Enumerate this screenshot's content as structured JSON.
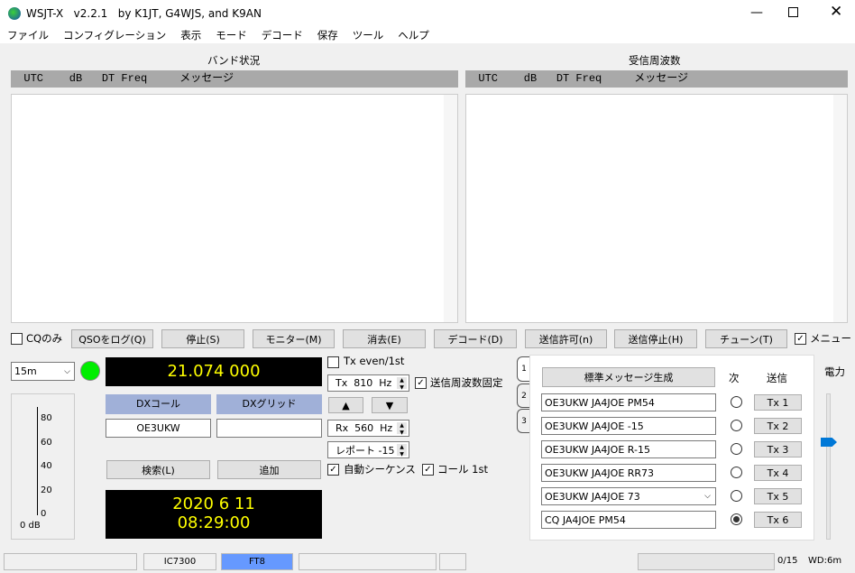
{
  "window": {
    "title": "WSJT-X   v2.2.1   by K1JT, G4WJS, and K9AN",
    "controls": [
      "minimize",
      "maximize",
      "close"
    ]
  },
  "menu": [
    "ファイル",
    "コンフィグレーション",
    "表示",
    "モード",
    "デコード",
    "保存",
    "ツール",
    "ヘルプ"
  ],
  "band_activity": {
    "title": "バンド状況",
    "header": "  UTC    dB   DT Freq     メッセージ"
  },
  "rx_frequency": {
    "title": "受信周波数",
    "header": "  UTC    dB   DT Freq     メッセージ"
  },
  "buttons": {
    "cq_only": "CQのみ",
    "log_qso": "QSOをログ(Q)",
    "stop": "停止(S)",
    "monitor": "モニター(M)",
    "erase": "消去(E)",
    "decode": "デコード(D)",
    "enable_tx": "送信許可(n)",
    "halt_tx": "送信停止(H)",
    "tune": "チューン(T)",
    "menus": "メニュー"
  },
  "checkboxes": {
    "cq_only": false,
    "menus": true,
    "tx_even": false,
    "hold_tx_freq": true,
    "auto_seq": true,
    "call_1st": true
  },
  "band": "15m",
  "frequency": "21.074 000",
  "meter": {
    "ticks": [
      "80",
      "60",
      "40",
      "20",
      "0"
    ],
    "label": "0 dB"
  },
  "dx": {
    "call_label": "DXコール",
    "grid_label": "DXグリッド",
    "call": "OE3UKW",
    "grid": ""
  },
  "lookup": "検索(L)",
  "add": "追加",
  "clock": {
    "date": "2020 6 11",
    "time": "08:29:00"
  },
  "tx_even_label": "Tx even/1st",
  "tx_freq": "Tx  810  Hz",
  "rx_freq": "Rx  560  Hz",
  "report": "レポート -15",
  "hold_tx_label": "送信周波数固定",
  "up": "▲",
  "down": "▼",
  "auto_seq_label": "自動シーケンス",
  "call_1st_label": "コール 1st",
  "tabs": [
    "1",
    "2",
    "3"
  ],
  "messages": {
    "generate": "標準メッセージ生成",
    "next_label": "次",
    "send_label": "送信",
    "rows": [
      {
        "text": "OE3UKW JA4JOE PM54",
        "tx": "Tx 1"
      },
      {
        "text": "OE3UKW JA4JOE -15",
        "tx": "Tx 2"
      },
      {
        "text": "OE3UKW JA4JOE R-15",
        "tx": "Tx 3"
      },
      {
        "text": "OE3UKW JA4JOE RR73",
        "tx": "Tx 4"
      },
      {
        "text": "OE3UKW JA4JOE 73",
        "tx": "Tx 5"
      },
      {
        "text": "CQ JA4JOE PM54",
        "tx": "Tx 6"
      }
    ],
    "selected_next": 6
  },
  "power": {
    "label": "電力"
  },
  "status": {
    "rig": "IC7300",
    "mode": "FT8",
    "progress": "0/15",
    "wd": "WD:6m",
    "mode_color": "#6699ff"
  }
}
